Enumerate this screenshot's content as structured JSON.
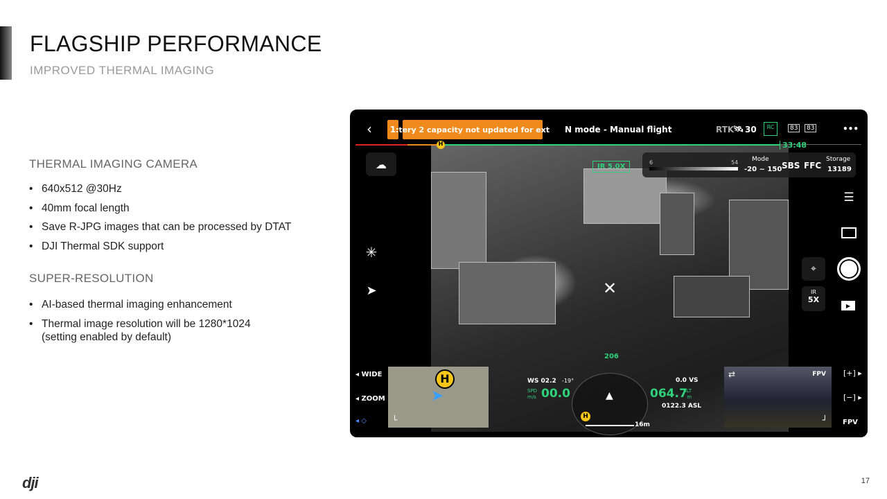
{
  "slide": {
    "title": "FLAGSHIP PERFORMANCE",
    "subtitle": "IMPROVED THERMAL IMAGING",
    "page_number": "17",
    "logo": "dji"
  },
  "sections": [
    {
      "heading": "THERMAL IMAGING CAMERA",
      "bullets": [
        "640x512 @30Hz",
        "40mm focal length",
        "Save R-JPG images that can be processed by DTAT",
        "DJI Thermal SDK support"
      ]
    },
    {
      "heading": "SUPER-RESOLUTION",
      "bullets": [
        "AI-based thermal imaging enhancement",
        "Thermal image resolution will be 1280*1024",
        "(setting enabled by default)"
      ]
    }
  ],
  "app": {
    "alert_count": "1",
    "alert_text": ":tery 2 capacity not updated for ext",
    "flight_mode": "N mode - Manual flight",
    "rtk": "RTK",
    "satellites": "30",
    "rc": "RC",
    "battery1": "83",
    "battery2": "83",
    "more": "•••",
    "flight_time": "33:48",
    "ir_zoom_badge": "IR 5.0X",
    "palette_min": "6",
    "palette_max": "54",
    "mode_label": "Mode",
    "mode_value": "-20 ~ 150",
    "sbs": "SBS",
    "ffc": "FFC",
    "storage_label": "Storage",
    "storage_value": "13189",
    "ir_label": "IR",
    "zoom_value": "5X",
    "wide": "WIDE",
    "zoom": "ZOOM",
    "fpv": "FPV",
    "fpv_label": "FPV",
    "ws": "WS 02.2",
    "wind_angle": "-19°",
    "spd_label": "SPD",
    "spd_unit": "m/s",
    "spd_value": "00.0",
    "heading": "206",
    "vs": "0.0 VS",
    "alt_value": "064.7",
    "alt_label": "ALT",
    "alt_unit": "m",
    "asl": "0122.3 ASL",
    "scale": "16m",
    "home": "H",
    "colors": {
      "orange": "#f08a1c",
      "green": "#2fd27a",
      "home_yellow": "#f5c518"
    }
  }
}
